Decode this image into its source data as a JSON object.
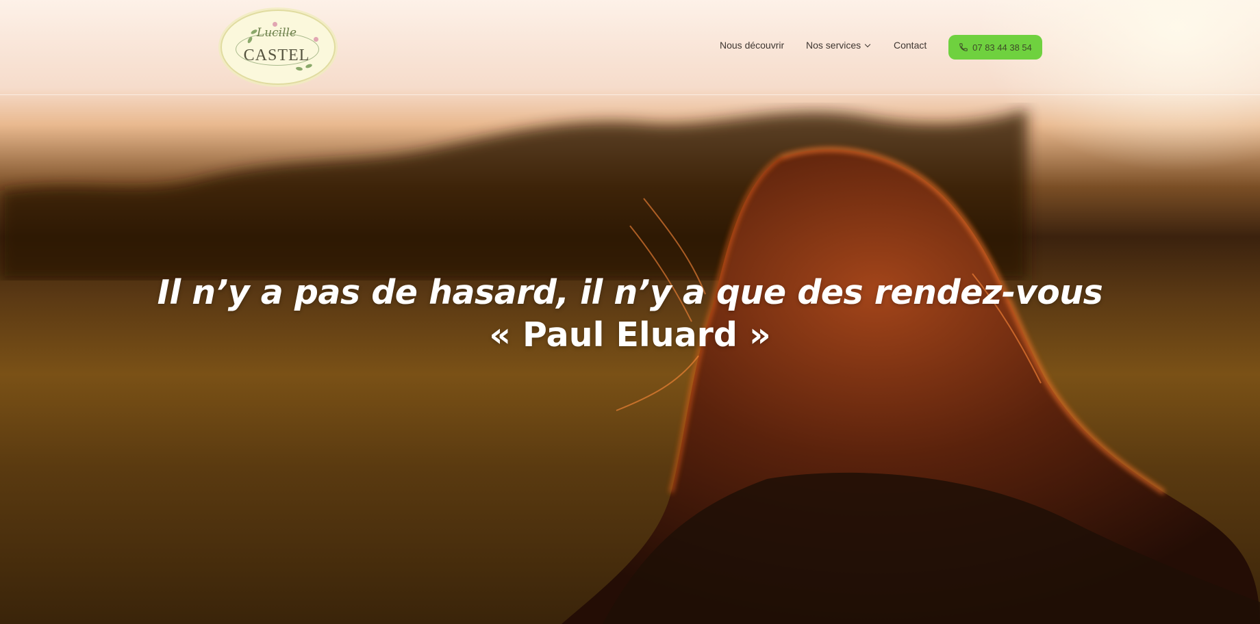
{
  "brand": {
    "logo_script": "Lucille",
    "logo_name": "CASTEL"
  },
  "nav": {
    "items": [
      {
        "label": "Nous découvrir"
      },
      {
        "label": "Nos services",
        "has_dropdown": true
      },
      {
        "label": "Contact"
      }
    ],
    "phone": {
      "label": "07 83 44 38 54",
      "icon": "phone-icon",
      "color": "#6fd13f"
    }
  },
  "hero": {
    "quote": "Il n’y a pas de hasard, il n’y a que des rendez-vous",
    "author": "« Paul Eluard »"
  }
}
